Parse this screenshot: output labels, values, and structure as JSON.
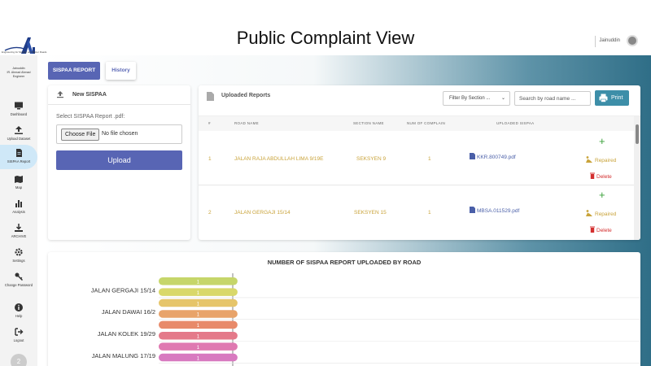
{
  "header": {
    "title": "Public Complaint View",
    "user_name": "Jainuddin"
  },
  "logo": {
    "text": "Engineering for Monitor and Better Roads"
  },
  "sidebar": {
    "user_lines": [
      "Jainuddin",
      "IR. Ahmad Ahmad",
      "Engineer"
    ],
    "items": [
      {
        "label": "Dashboard",
        "icon": "monitor-icon"
      },
      {
        "label": "Upload Dataset",
        "icon": "upload-icon"
      },
      {
        "label": "SISPAA Report",
        "icon": "document-icon",
        "active": true
      },
      {
        "label": "Map",
        "icon": "map-icon"
      },
      {
        "label": "Analysis",
        "icon": "bar-chart-icon"
      },
      {
        "label": "ARCHIVE",
        "icon": "archive-icon"
      },
      {
        "label": "Settings",
        "icon": "gear-icon"
      },
      {
        "label": "Change Password",
        "icon": "key-icon"
      },
      {
        "label": "Help",
        "icon": "info-icon"
      },
      {
        "label": "Logout",
        "icon": "logout-icon"
      }
    ],
    "bottom_badge": "2"
  },
  "tabs": {
    "sispaa": "SISPAA REPORT",
    "history": "History"
  },
  "new_sispaa": {
    "title": "New SISPAA",
    "select_label": "Select SISPAA Report .pdf:",
    "choose_file": "Choose File",
    "no_file": "No file chosen",
    "upload": "Upload"
  },
  "reports": {
    "title": "Uploaded Reports",
    "filter_placeholder": "Filter By Section ...",
    "search_placeholder": "Search by road name ...",
    "print": "Print",
    "columns": [
      "#",
      "ROAD NAME",
      "SECTION NAME",
      "NUM OF COMPLAIN",
      "UPLOADED SISPAA"
    ],
    "rows": [
      {
        "num": "1",
        "road": "JALAN RAJA ABDULLAH LIMA 9/19E",
        "section": "SEKSYEN 9",
        "complaints": "1",
        "file": "KKR.800749.pdf"
      },
      {
        "num": "2",
        "road": "JALAN GERGAJI 15/14",
        "section": "SEKSYEN 15",
        "complaints": "1",
        "file": "MBSA.011529.pdf"
      }
    ],
    "action_add": "+",
    "action_repaired": "Repaired",
    "action_delete": "Delete"
  },
  "chart_data": {
    "type": "bar",
    "title": "NUMBER OF SISPAA REPORT UPLOADED BY ROAD",
    "orientation": "horizontal",
    "categories": [
      "",
      "JALAN GERGAJI 15/14",
      "",
      "JALAN DAWAI 16/2",
      "",
      "JALAN KOLEK 19/29",
      "",
      "JALAN MALUNG 17/19"
    ],
    "values": [
      1,
      1,
      1,
      1,
      1,
      1,
      1,
      1
    ],
    "colors": [
      "#c6d66a",
      "#d9d86a",
      "#e6c56a",
      "#e8a36a",
      "#e88a6a",
      "#e47a8a",
      "#df79b1",
      "#d87ac0"
    ],
    "xlim": [
      0,
      3
    ]
  }
}
